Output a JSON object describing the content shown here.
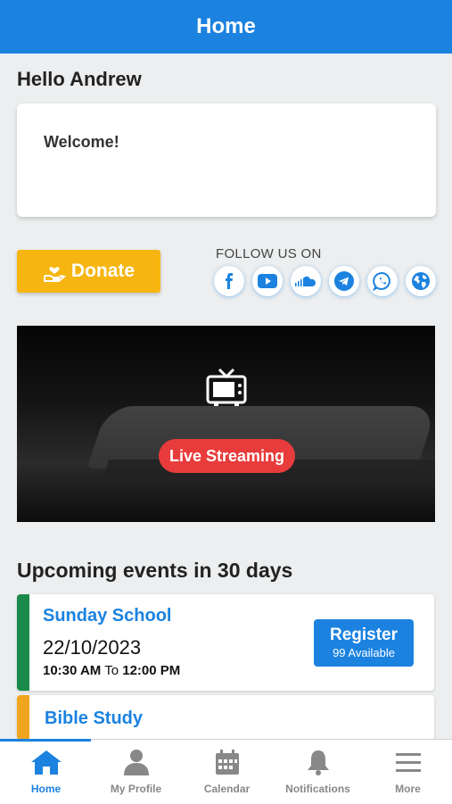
{
  "header": {
    "title": "Home"
  },
  "greeting": "Hello Andrew",
  "welcome": {
    "text": "Welcome!"
  },
  "donate": {
    "label": "Donate"
  },
  "follow": {
    "label": "FOLLOW US ON",
    "icons": [
      "facebook-icon",
      "youtube-icon",
      "soundcloud-icon",
      "telegram-icon",
      "whatsapp-icon",
      "globe-icon"
    ]
  },
  "live": {
    "label": "Live Streaming"
  },
  "events": {
    "title": "Upcoming events in 30 days",
    "items": [
      {
        "name": "Sunday School",
        "date": "22/10/2023",
        "start": "10:30 AM",
        "to": "To",
        "end": "12:00 PM",
        "register": "Register",
        "available": "99 Available",
        "color": "#1a8a4a"
      },
      {
        "name": "Bible Study",
        "color": "#f0a51e"
      }
    ]
  },
  "tabs": [
    {
      "label": "Home",
      "icon": "home-icon",
      "active": true
    },
    {
      "label": "My Profile",
      "icon": "user-icon"
    },
    {
      "label": "Calendar",
      "icon": "calendar-icon"
    },
    {
      "label": "Notifications",
      "icon": "bell-icon"
    },
    {
      "label": "More",
      "icon": "menu-icon"
    }
  ],
  "colors": {
    "primary": "#1b82e0",
    "donate": "#f6b511",
    "live": "#e83b3b"
  }
}
